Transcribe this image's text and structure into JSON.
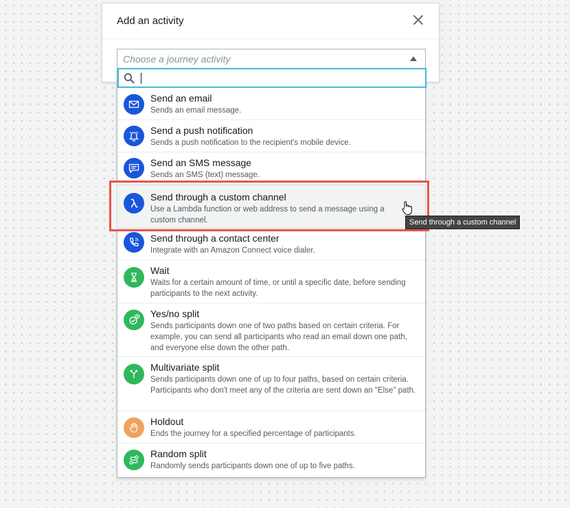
{
  "dialog": {
    "title": "Add an activity",
    "close_icon": "close-icon",
    "select": {
      "placeholder": "Choose a journey activity"
    },
    "search": {
      "value": ""
    }
  },
  "activities": [
    {
      "title": "Send an email",
      "desc": "Sends an email message.",
      "icon": "envelope-icon",
      "color": "#1a56db"
    },
    {
      "title": "Send a push notification",
      "desc": "Sends a push notification to the recipient's mobile device.",
      "icon": "bell-icon",
      "color": "#1a56db"
    },
    {
      "title": "Send an SMS message",
      "desc": "Sends an SMS (text) message.",
      "icon": "chat-icon",
      "color": "#1a56db"
    },
    {
      "title": "Send through a custom channel",
      "desc": "Use a Lambda function or web address to send a message using a custom channel.",
      "icon": "lambda-icon",
      "color": "#1a56db",
      "highlighted": true
    },
    {
      "title": "Send through a contact center",
      "desc": "Integrate with an Amazon Connect voice dialer.",
      "icon": "phone-icon",
      "color": "#1a56db"
    },
    {
      "title": "Wait",
      "desc": "Waits for a certain amount of time, or until a specific date, before sending participants to the next activity.",
      "icon": "hourglass-icon",
      "color": "#2eb85c"
    },
    {
      "title": "Yes/no split",
      "desc": "Sends participants down one of two paths based on certain criteria. For example, you can send all participants who read an email down one path, and everyone else down the other path.",
      "icon": "check-x-icon",
      "color": "#2eb85c"
    },
    {
      "title": "Multivariate split",
      "desc": "Sends participants down one of up to four paths, based on certain criteria. Participants who don't meet any of the criteria are sent down an \"Else\" path.",
      "icon": "fork-icon",
      "color": "#2eb85c"
    },
    {
      "title": "Holdout",
      "desc": "Ends the journey for a specified percentage of participants.",
      "icon": "hand-icon",
      "color": "#f0a35e"
    },
    {
      "title": "Random split",
      "desc": "Randomly sends participants down one of up to five paths.",
      "icon": "random-path-icon",
      "color": "#2eb85c"
    }
  ],
  "tooltip": {
    "text": "Send through a custom channel"
  }
}
